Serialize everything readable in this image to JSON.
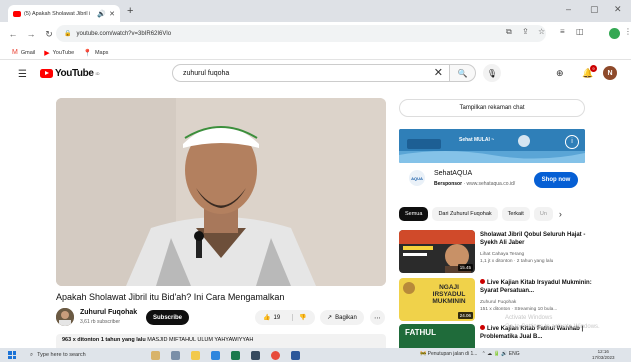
{
  "browser": {
    "tab_title": "(5) Apakah Sholawat Jibril i",
    "url": "youtube.com/watch?v=3bIR62I6Vlo",
    "bookmarks": [
      {
        "label": "Gmail",
        "icon": "gmail-icon"
      },
      {
        "label": "YouTube",
        "icon": "youtube-icon"
      },
      {
        "label": "Maps",
        "icon": "maps-icon"
      }
    ]
  },
  "header": {
    "logo_text": "YouTube",
    "logo_region": "ID",
    "search_value": "zuhurul fuqoha",
    "notif_count": "9",
    "avatar_letter": "N"
  },
  "video": {
    "title": "Apakah Sholawat Jibril itu Bid'ah? Ini Cara Mengamalkan",
    "channel_name": "Zuhurul Fuqohak",
    "subscribers": "3,61 rb subscriber",
    "subscribe_label": "Subscribe",
    "likes": "19",
    "share_label": "Bagikan",
    "desc_views": "963 x ditonton",
    "desc_date": "1 tahun yang lalu",
    "desc_text": "MASJID MIFTAHUL ULUM YAHYAWIYYAH"
  },
  "sidebar": {
    "chat_label": "Tampilkan rekaman chat",
    "ad": {
      "banner_text": "Sehat MULAI ~",
      "name": "SehatAQUA",
      "sponsor_label": "Bersponsor",
      "sponsor_url": "www.sehataqua.co.id/",
      "logo_text": "AQUA",
      "cta": "Shop now"
    },
    "chips": [
      "Semua",
      "Dari Zuhurul Fuqohak",
      "Terkait",
      "Un"
    ],
    "recommendations": [
      {
        "title": "Sholawat Jibril Qobul Seluruh Hajat - Syekh Ali Jaber",
        "channel": "Lihat Cahaya Terang",
        "meta": "1,1 jt x ditonton · 2 tahun yang lalu",
        "duration": "15.45",
        "live": false
      },
      {
        "title": "Live Kajian Kitab Irsyadul Mukminin: Syarat Persatuan...",
        "channel": "Zuhurul Fuqohak",
        "meta": "151 x ditonton · Streaming 10 bula...",
        "duration": "24.06",
        "thumb_text": "NGAJI IRSYADUL MUKMININ",
        "live": true
      },
      {
        "title": "Live Kajian Kitab Fathul Wahhab | Problematika Jual B...",
        "channel": "",
        "meta": "",
        "duration": "",
        "thumb_text": "FATHUL",
        "live": true
      }
    ]
  },
  "windows": {
    "watermark_line1": "Activate Windows",
    "watermark_line2": "Go to Settings to activate Windows.",
    "taskbar_search": "Type here to search",
    "tray_text": "Penutupan jalan di 1...",
    "lang": "ENG",
    "time": "12:16",
    "date": "17/03/2023"
  },
  "colors": {
    "youtube_red": "#ff0000",
    "subscribe_bg": "#0f0f0f",
    "shop_now_bg": "#065fd4",
    "live_red": "#cc0000"
  }
}
